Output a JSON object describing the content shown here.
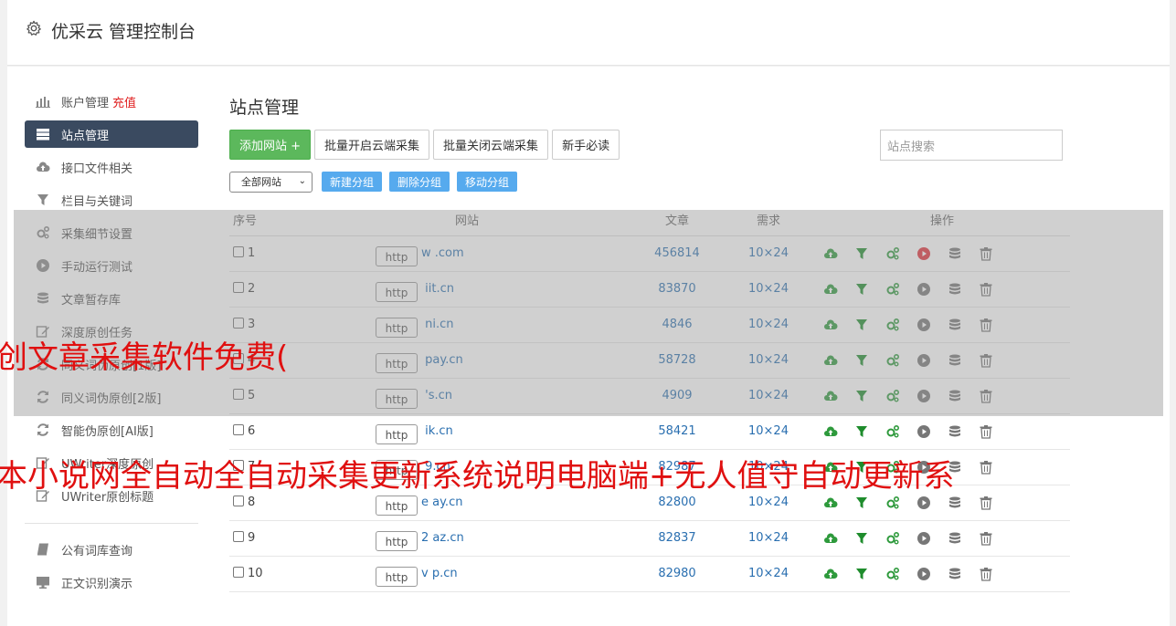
{
  "header": {
    "title": "优采云 管理控制台"
  },
  "sidebar": {
    "items": [
      {
        "label": "账户管理",
        "extra": "充值",
        "icon": "bar-chart-icon"
      },
      {
        "label": "站点管理",
        "icon": "server-icon",
        "active": true
      },
      {
        "label": "接口文件相关",
        "icon": "cloud-upload-icon"
      },
      {
        "label": "栏目与关键词",
        "icon": "filter-icon"
      },
      {
        "label": "采集细节设置",
        "icon": "cogs-icon"
      },
      {
        "label": "手动运行测试",
        "icon": "play-icon"
      },
      {
        "label": "文章暂存库",
        "icon": "database-icon"
      },
      {
        "label": "深度原创任务",
        "icon": "edit-icon"
      },
      {
        "label": "同义词伪原创[1版]",
        "icon": "refresh-icon"
      },
      {
        "label": "同义词伪原创[2版]",
        "icon": "refresh-icon"
      },
      {
        "label": "智能伪原创[AI版]",
        "icon": "refresh-icon"
      },
      {
        "label": "UWriter深度原创",
        "icon": "edit-icon"
      },
      {
        "label": "UWriter原创标题",
        "icon": "edit-icon"
      }
    ],
    "items2": [
      {
        "label": "公有词库查询",
        "icon": "book-icon"
      },
      {
        "label": "正文识别演示",
        "icon": "monitor-icon"
      }
    ]
  },
  "main": {
    "title": "站点管理",
    "add_site": "添加网站 +",
    "batch_open": "批量开启云端采集",
    "batch_close": "批量关闭云端采集",
    "newbie": "新手必读",
    "search_placeholder": "站点搜索",
    "group_select": "全部网站",
    "new_group": "新建分组",
    "delete_group": "删除分组",
    "move_group": "移动分组",
    "columns": {
      "index": "序号",
      "site": "网站",
      "articles": "文章",
      "demand": "需求",
      "ops": "操作"
    },
    "rows": [
      {
        "index": "1",
        "http": "http",
        "domain": "w          .com",
        "articles": "456814",
        "demand": "10×24"
      },
      {
        "index": "2",
        "http": "http",
        "domain": "    iit.cn",
        "articles": "83870",
        "demand": "10×24"
      },
      {
        "index": "3",
        "http": "http",
        "domain": "     ni.cn",
        "articles": "4846",
        "demand": "10×24"
      },
      {
        "index": "4",
        "http": "http",
        "domain": "      pay.cn",
        "articles": "58728",
        "demand": "10×24"
      },
      {
        "index": "5",
        "http": "http",
        "domain": "      's.cn",
        "articles": "4909",
        "demand": "10×24"
      },
      {
        "index": "6",
        "http": "http",
        "domain": "      ik.cn",
        "articles": "58421",
        "demand": "10×24"
      },
      {
        "index": "7",
        "http": "http",
        "domain": "      9.cn",
        "articles": "82987",
        "demand": "10×24"
      },
      {
        "index": "8",
        "http": "http",
        "domain": "e     ay.cn",
        "articles": "82800",
        "demand": "10×24"
      },
      {
        "index": "9",
        "http": "http",
        "domain": "2     az.cn",
        "articles": "82837",
        "demand": "10×24"
      },
      {
        "index": "10",
        "http": "http",
        "domain": "v     p.cn",
        "articles": "82980",
        "demand": "10×24"
      }
    ]
  },
  "overlay": {
    "line1": "创文章采集软件免费(",
    "line2": "本小说网全自动全自动采集更新系统说明电脑端+无人值守自动更新系"
  },
  "colors": {
    "active_nav": "#3a4a60",
    "green": "#5cb85c",
    "blue_btn": "#56aaee",
    "link": "#2a6fb0",
    "overlay_red": "#e01010"
  }
}
